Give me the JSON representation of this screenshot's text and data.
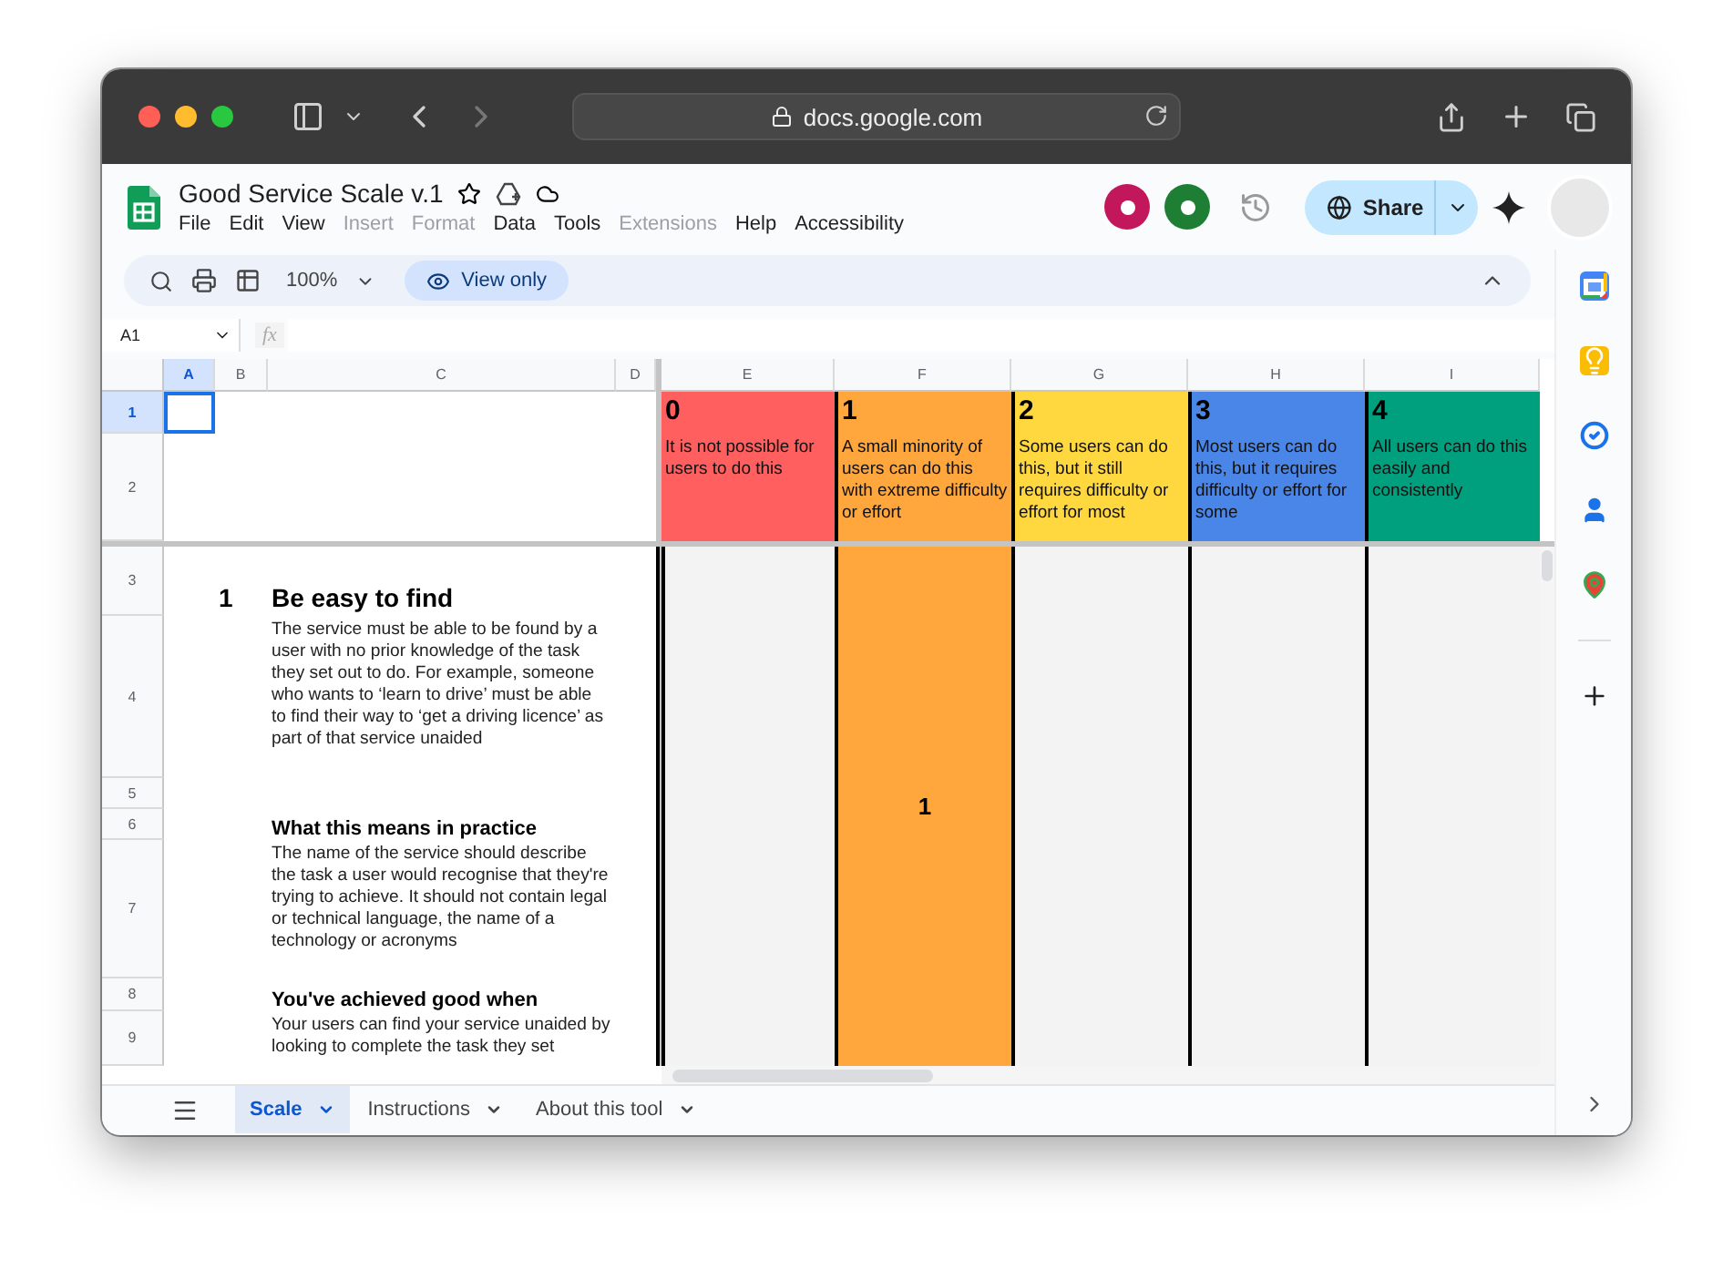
{
  "browser": {
    "url": "docs.google.com"
  },
  "document": {
    "title": "Good Service Scale v.1",
    "menu": [
      {
        "label": "File",
        "disabled": false
      },
      {
        "label": "Edit",
        "disabled": false
      },
      {
        "label": "View",
        "disabled": false
      },
      {
        "label": "Insert",
        "disabled": true
      },
      {
        "label": "Format",
        "disabled": true
      },
      {
        "label": "Data",
        "disabled": false
      },
      {
        "label": "Tools",
        "disabled": false
      },
      {
        "label": "Extensions",
        "disabled": true
      },
      {
        "label": "Help",
        "disabled": false
      },
      {
        "label": "Accessibility",
        "disabled": false
      }
    ],
    "collaborators": [
      {
        "color": "#c2185b"
      },
      {
        "color": "#1e7e34"
      }
    ],
    "share_label": "Share"
  },
  "toolbar": {
    "zoom": "100%",
    "mode": "View only"
  },
  "formula_bar": {
    "name_box": "A1",
    "fx": "fx"
  },
  "grid": {
    "columns": [
      {
        "label": "A",
        "selected": true
      },
      {
        "label": "B",
        "selected": false
      },
      {
        "label": "C",
        "selected": false
      },
      {
        "label": "D",
        "selected": false
      },
      {
        "label": "E",
        "selected": false
      },
      {
        "label": "F",
        "selected": false
      },
      {
        "label": "G",
        "selected": false
      },
      {
        "label": "H",
        "selected": false
      },
      {
        "label": "I",
        "selected": false
      }
    ],
    "rows": [
      {
        "label": "1",
        "selected": true
      },
      {
        "label": "2",
        "selected": false
      },
      {
        "label": "3",
        "selected": false
      },
      {
        "label": "4",
        "selected": false
      },
      {
        "label": "5",
        "selected": false
      },
      {
        "label": "6",
        "selected": false
      },
      {
        "label": "7",
        "selected": false
      },
      {
        "label": "8",
        "selected": false
      },
      {
        "label": "9",
        "selected": false
      }
    ]
  },
  "scale": [
    {
      "score": "0",
      "description": "It is not possible for users to do this",
      "color": "#ff5f5f",
      "selected": false
    },
    {
      "score": "1",
      "description": "A small minority of users can do this with extreme difficulty or effort",
      "color": "#ffa63d",
      "selected": true
    },
    {
      "score": "2",
      "description": "Some users can do this, but it still requires difficulty or effort for most",
      "color": "#ffd83f",
      "selected": false
    },
    {
      "score": "3",
      "description": "Most users can do this, but it requires difficulty or effort for some",
      "color": "#4a86e8",
      "selected": false
    },
    {
      "score": "4",
      "description": "All users can do this easily and consistently",
      "color": "#00a07e",
      "selected": false
    }
  ],
  "rating": "1",
  "principle": {
    "number": "1",
    "title": "Be easy to find",
    "description": "The service must be able to be found by a user with no prior knowledge of the task they set out to do. For example, someone who wants to ‘learn to drive’ must be able to find their way to ‘get a driving licence’ as part of that service unaided",
    "sections": [
      {
        "heading": "What this means in practice",
        "text": "The name of the service should describe the task a user would recognise that they're trying to achieve. It should not contain legal or technical language, the name of a technology or acronyms"
      },
      {
        "heading": "You've achieved good when",
        "text": "Your users can find your service unaided by looking to complete the task they set"
      }
    ]
  },
  "sheet_tabs": [
    {
      "label": "Scale",
      "selected": true
    },
    {
      "label": "Instructions",
      "selected": false
    },
    {
      "label": "About this tool",
      "selected": false
    }
  ]
}
